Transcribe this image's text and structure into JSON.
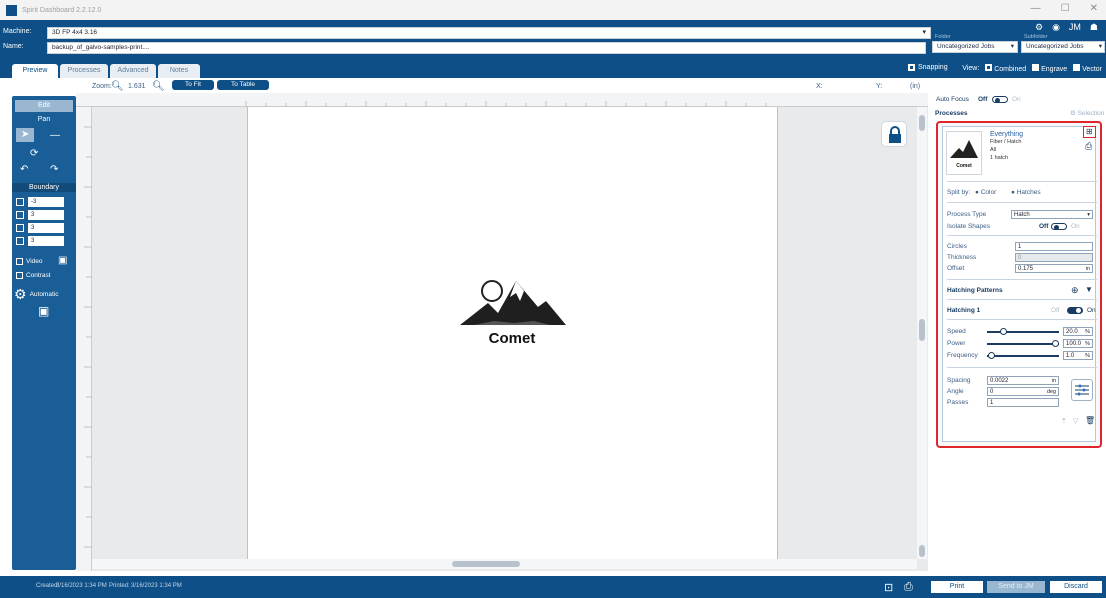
{
  "window": {
    "title": "Spirit Dashboard 2.2.12.0",
    "controls": [
      "—",
      "☐",
      "✕"
    ]
  },
  "header": {
    "machine_label": "Machine:",
    "machine_value": "3D FP 4x4 3.16",
    "name_label": "Name:",
    "name_value": "backup_of_galvo-samples-print....",
    "folder_label": "Folder",
    "folder_value": "Uncategorized Jobs",
    "subfolder_label": "Subfolder",
    "subfolder_value": "Uncategorized Jobs"
  },
  "tabs": [
    {
      "label": "Preview",
      "active": true
    },
    {
      "label": "Processes",
      "active": false
    },
    {
      "label": "Advanced",
      "active": false
    },
    {
      "label": "Notes",
      "active": false
    }
  ],
  "view_options": {
    "snapping_label": "Snapping",
    "view_label": "View:",
    "combined_label": "Combined",
    "engrave_label": "Engrave",
    "vector_label": "Vector"
  },
  "zoom": {
    "label": "Zoom:",
    "value": "1.631",
    "to_fit": "To Fit",
    "to_table": "To Table",
    "x_label": "X:",
    "y_label": "Y:",
    "units": "(in)"
  },
  "left_panel": {
    "edit_label": "Edit",
    "pan_label": "Pan",
    "boundary_label": "Boundary",
    "boundary_values": [
      "-3",
      "3",
      "3",
      "3"
    ],
    "video_label": "Video",
    "contrast_label": "Contrast",
    "automatic_label": "Automatic"
  },
  "canvas": {
    "artwork_text": "Comet"
  },
  "right_panel": {
    "auto_focus_label": "Auto Focus",
    "auto_focus_off": "Off",
    "auto_focus_on": "On",
    "processes_label": "Processes",
    "selection_label": "Selection",
    "process": {
      "name": "Everything",
      "type_line": "Fiber / Hatch",
      "line3": "All",
      "line4": "1 hatch",
      "thumb_text": "Comet"
    },
    "split_by_label": "Split by:",
    "split_color": "Color",
    "split_hatches": "Hatches",
    "process_type_label": "Process Type",
    "process_type_value": "Hatch",
    "isolate_shapes_label": "Isolate Shapes",
    "isolate_off": "Off",
    "isolate_on": "On",
    "circles_label": "Circles",
    "circles_value": "1",
    "thickness_label": "Thickness",
    "thickness_value": "0",
    "offset_label": "Offset",
    "offset_value": "0.175",
    "offset_unit": "in",
    "hatching_patterns_label": "Hatching Patterns",
    "hatching_name": "Hatching 1",
    "hatching_off": "Off",
    "hatching_on": "On",
    "speed_label": "Speed",
    "speed_value": "20.0",
    "speed_fraction": 0.2,
    "power_label": "Power",
    "power_value": "100.0",
    "power_fraction": 1.0,
    "frequency_label": "Frequency",
    "frequency_value": "1.0",
    "frequency_fraction": 0.01,
    "percent_unit": "%",
    "spacing_label": "Spacing",
    "spacing_value": "0.0022",
    "spacing_unit": "in",
    "angle_label": "Angle",
    "angle_value": "0",
    "angle_unit": "deg",
    "passes_label": "Passes",
    "passes_value": "1"
  },
  "status": {
    "created_label": "Created:",
    "created_value": "3/16/2023 1:34 PM",
    "printed_label": "Printed:",
    "printed_value": "3/16/2023 1:34 PM",
    "print_label": "Print",
    "send_label": "Send to JM",
    "discard_label": "Discard"
  },
  "colors": {
    "brand": "#0d4f86",
    "highlight": "#e0262c"
  }
}
